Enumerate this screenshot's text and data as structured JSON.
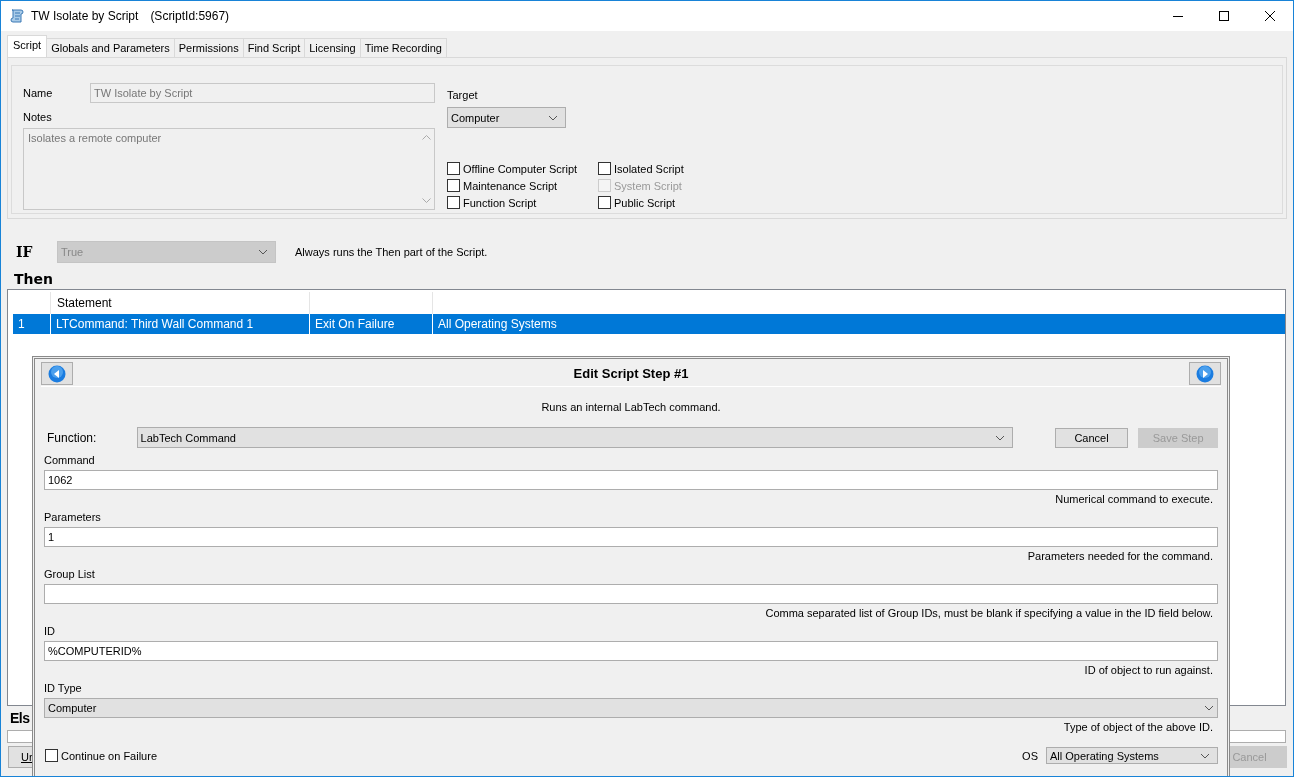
{
  "window": {
    "title": "TW Isolate by Script",
    "script_id": "(ScriptId:5967)"
  },
  "tabs": [
    {
      "label": "Script",
      "selected": true
    },
    {
      "label": "Globals and Parameters",
      "selected": false
    },
    {
      "label": "Permissions",
      "selected": false
    },
    {
      "label": "Find Script",
      "selected": false
    },
    {
      "label": "Licensing",
      "selected": false
    },
    {
      "label": "Time Recording",
      "selected": false
    }
  ],
  "script": {
    "name_label": "Name",
    "name": "TW Isolate by Script",
    "notes_label": "Notes",
    "notes": "Isolates a remote computer",
    "target_label": "Target",
    "target": "Computer",
    "options": [
      {
        "label": "Offline Computer Script",
        "checked": false,
        "disabled": false
      },
      {
        "label": "Isolated Script",
        "checked": false,
        "disabled": false
      },
      {
        "label": "Maintenance Script",
        "checked": false,
        "disabled": false
      },
      {
        "label": "System Script",
        "checked": false,
        "disabled": true
      },
      {
        "label": "Function Script",
        "checked": false,
        "disabled": false
      },
      {
        "label": "Public Script",
        "checked": false,
        "disabled": false
      }
    ]
  },
  "condition": {
    "label": "IF",
    "value": "True",
    "disabled": true,
    "description": "Always runs the Then part of the Script."
  },
  "then": {
    "label": "Then",
    "header": {
      "column_2": "Statement"
    },
    "rows": [
      {
        "number": "1",
        "statement": "LTCommand: Third Wall Command 1",
        "column_3": "Exit On Failure",
        "column_4": "All Operating Systems",
        "selected": true
      }
    ]
  },
  "else": {
    "label": "Els"
  },
  "buttons": [
    {
      "label": "Ur",
      "disabled": false
    },
    {
      "label": "Cancel",
      "disabled": true
    }
  ],
  "dialog": {
    "title": "Edit Script Step #1",
    "description": "Runs an internal LabTech command.",
    "function_label": "Function:",
    "function": "LabTech Command",
    "buttons": [
      {
        "label": "Cancel",
        "disabled": false
      },
      {
        "label": "Save Step",
        "disabled": true
      }
    ],
    "fields": [
      {
        "kind": "text",
        "label": "Command",
        "value": "1062",
        "hint": "Numerical command to execute."
      },
      {
        "kind": "text",
        "label": "Parameters",
        "value": "1",
        "hint": "Parameters needed for the command."
      },
      {
        "kind": "text",
        "label": "Group List",
        "hint": "Comma separated list of Group IDs, must be blank if specifying a value in the ID field below."
      },
      {
        "kind": "text",
        "label": "ID",
        "value": "%COMPUTERID%",
        "hint": "ID of object to run against."
      },
      {
        "kind": "select",
        "label": "ID Type",
        "value": "Computer",
        "hint": "Type of object of the above ID."
      }
    ],
    "continue_on_failure": {
      "label": "Continue on Failure",
      "checked": false
    },
    "os": {
      "label": "OS",
      "value": "All Operating Systems"
    }
  }
}
